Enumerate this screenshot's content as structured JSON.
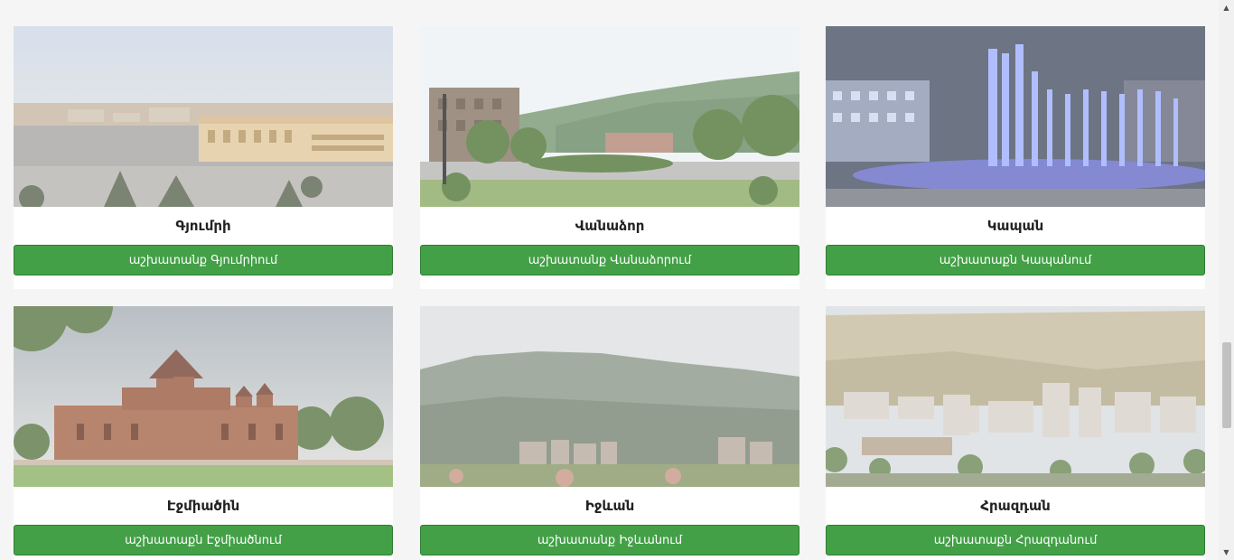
{
  "cities": [
    {
      "name": "Գյումրի",
      "button": "աշխատանք Գյումրիում"
    },
    {
      "name": "Վանաձոր",
      "button": "աշխատանք Վանաձորում"
    },
    {
      "name": "Կապան",
      "button": "աշխատաքն Կապանում"
    },
    {
      "name": "Էջմիածին",
      "button": "աշխատաքն Էջմիածնում"
    },
    {
      "name": "Իջևան",
      "button": "աշխատանք Իջևանում"
    },
    {
      "name": "Հրազդան",
      "button": "աշխատաքն Հրազդանում"
    }
  ],
  "colors": {
    "button": "#43a047",
    "background": "#f5f5f5"
  },
  "scrollbar": {
    "up_icon": "▲",
    "down_icon": "▼"
  }
}
